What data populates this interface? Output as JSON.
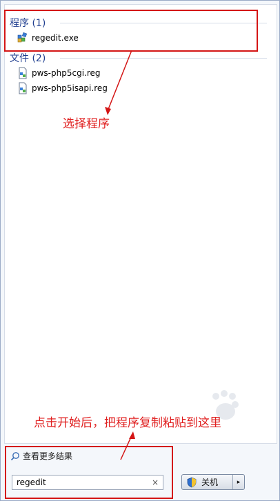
{
  "results": {
    "programs": {
      "header": "程序 (1)",
      "items": [
        {
          "label": "regedit.exe",
          "icon": "regedit-icon"
        }
      ]
    },
    "files": {
      "header": "文件 (2)",
      "items": [
        {
          "label": "pws-php5cgi.reg",
          "icon": "reg-file-icon"
        },
        {
          "label": "pws-php5isapi.reg",
          "icon": "reg-file-icon"
        }
      ]
    }
  },
  "annotations": {
    "select_program": "选择程序",
    "paste_instruction": "点击开始后，把程序复制粘贴到这里"
  },
  "footer": {
    "see_more": "查看更多结果",
    "search_value": "regedit",
    "clear_symbol": "×",
    "shutdown_label": "关机",
    "shutdown_arrow": "▸"
  },
  "colors": {
    "annotation_red": "#e02020",
    "header_blue": "#1e3d8f"
  }
}
